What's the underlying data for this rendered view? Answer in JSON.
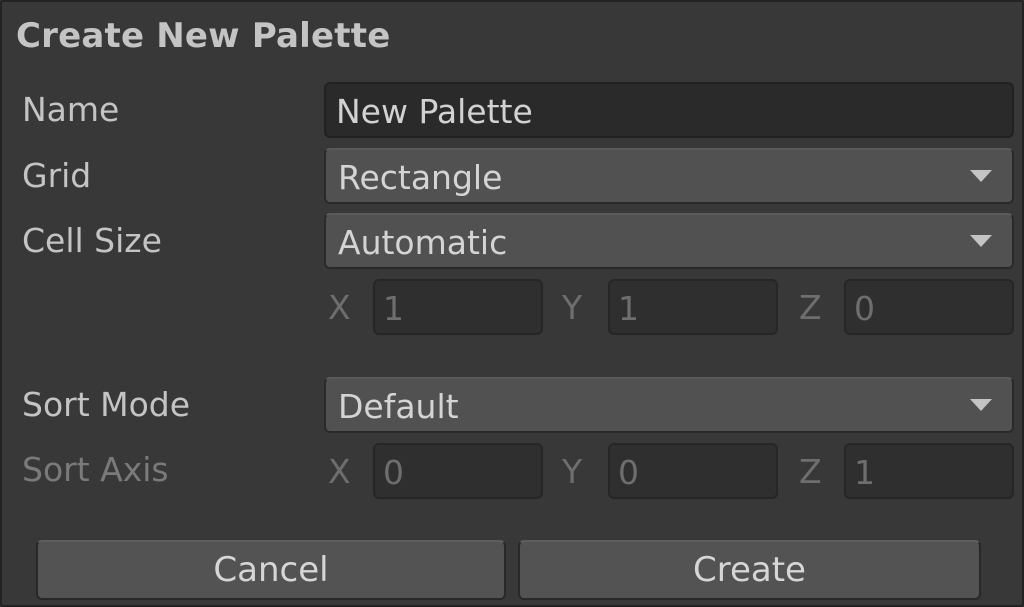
{
  "dialog": {
    "title": "Create New Palette"
  },
  "fields": {
    "name": {
      "label": "Name",
      "value": "New Palette"
    },
    "grid": {
      "label": "Grid",
      "value": "Rectangle"
    },
    "cell_size": {
      "label": "Cell Size",
      "value": "Automatic",
      "x_label": "X",
      "x": "1",
      "y_label": "Y",
      "y": "1",
      "z_label": "Z",
      "z": "0"
    },
    "sort_mode": {
      "label": "Sort Mode",
      "value": "Default"
    },
    "sort_axis": {
      "label": "Sort Axis",
      "x_label": "X",
      "x": "0",
      "y_label": "Y",
      "y": "0",
      "z_label": "Z",
      "z": "1"
    }
  },
  "buttons": {
    "cancel": "Cancel",
    "create": "Create"
  },
  "colors": {
    "background": "#383838",
    "text": "#c4c4c4",
    "disabled_text": "#6e6e6e",
    "button": "#535353",
    "field": "#2a2a2a"
  },
  "icons": {
    "dropdown": "triangle-down"
  }
}
